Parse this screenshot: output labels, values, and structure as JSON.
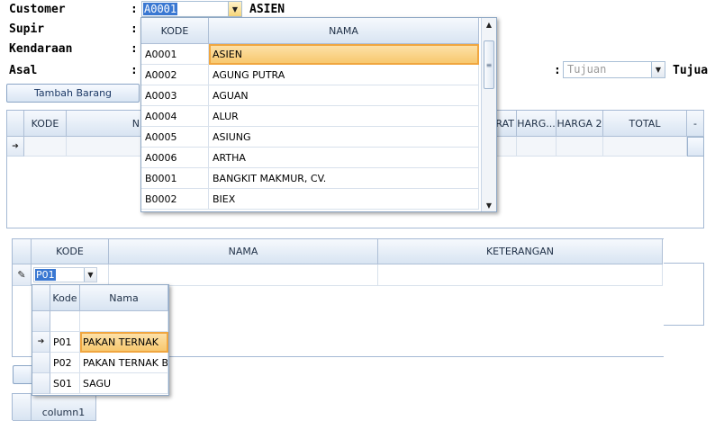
{
  "form": {
    "labels": {
      "customer": "Customer",
      "supir": "Supir",
      "kendaraan": "Kendaraan",
      "asal": "Asal"
    },
    "colon": ":",
    "customer_value": "A0001",
    "customer_name": "ASIEN",
    "tujuan_placeholder": "Tujuan",
    "tujuan_label_partial": "Tujua",
    "tambah_barang_label": "Tambah Barang"
  },
  "item_grid": {
    "columns": [
      "KODE",
      "N",
      "RAT",
      "HARG...",
      "HARGA 2",
      "TOTAL",
      "-"
    ],
    "new_row_marker": "➔"
  },
  "customer_dropdown": {
    "columns": [
      "KODE",
      "NAMA"
    ],
    "rows": [
      {
        "kode": "A0001",
        "nama": "ASIEN"
      },
      {
        "kode": "A0002",
        "nama": "AGUNG PUTRA"
      },
      {
        "kode": "A0003",
        "nama": "AGUAN"
      },
      {
        "kode": "A0004",
        "nama": "ALUR"
      },
      {
        "kode": "A0005",
        "nama": "ASIUNG"
      },
      {
        "kode": "A0006",
        "nama": "ARTHA"
      },
      {
        "kode": "B0001",
        "nama": "BANGKIT MAKMUR, CV."
      },
      {
        "kode": "B0002",
        "nama": "BIEX"
      }
    ],
    "selected_index": 0
  },
  "barang_grid": {
    "columns": [
      "KODE",
      "NAMA",
      "KETERANGAN"
    ],
    "edit_value": "P01",
    "edit_marker": "✎"
  },
  "barang_dropdown": {
    "columns": [
      "Kode",
      "Nama"
    ],
    "rows": [
      {
        "kode": "",
        "nama": ""
      },
      {
        "kode": "P01",
        "nama": "PAKAN TERNAK"
      },
      {
        "kode": "P02",
        "nama": "PAKAN TERNAK B"
      },
      {
        "kode": "S01",
        "nama": "SAGU"
      }
    ],
    "selected_index": 1,
    "row_marker": "➔"
  },
  "bottom_grid": {
    "columns": [
      "column1"
    ]
  },
  "colors": {
    "accent": "#3a78d2",
    "selection": "#f7c76b",
    "header": "#d8e4f2"
  }
}
